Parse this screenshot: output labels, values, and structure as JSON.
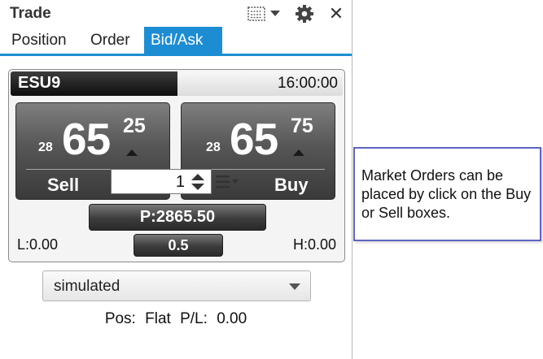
{
  "window": {
    "title": "Trade",
    "icons": [
      "layout-icon",
      "chevron-down-icon",
      "gear-icon",
      "close-icon"
    ],
    "close_glyph": "✕"
  },
  "tabs": [
    {
      "label": "Position",
      "active": false
    },
    {
      "label": "Order",
      "active": false
    },
    {
      "label": "Bid/Ask",
      "active": true
    }
  ],
  "instrument": {
    "symbol": "ESU9",
    "time": "16:00:00"
  },
  "bid": {
    "small": "28",
    "big": "65",
    "frac": "25",
    "label": "Sell"
  },
  "ask": {
    "small": "28",
    "big": "65",
    "frac": "75",
    "label": "Buy"
  },
  "quantity": "1",
  "price_button": "P:2865.50",
  "low": "L:0.00",
  "high": "H:0.00",
  "tick_button": "0.5",
  "account": {
    "selected": "simulated"
  },
  "status": {
    "pos_label": "Pos:",
    "pos_value": "Flat",
    "pl_label": "P/L:",
    "pl_value": "0.00"
  },
  "callout": {
    "text": "Market Orders can be placed by click on the Buy or Sell boxes."
  },
  "colors": {
    "accent": "#1c8dd3",
    "callout_border": "#5d64c2",
    "button_dark": "#3c3c3c"
  }
}
